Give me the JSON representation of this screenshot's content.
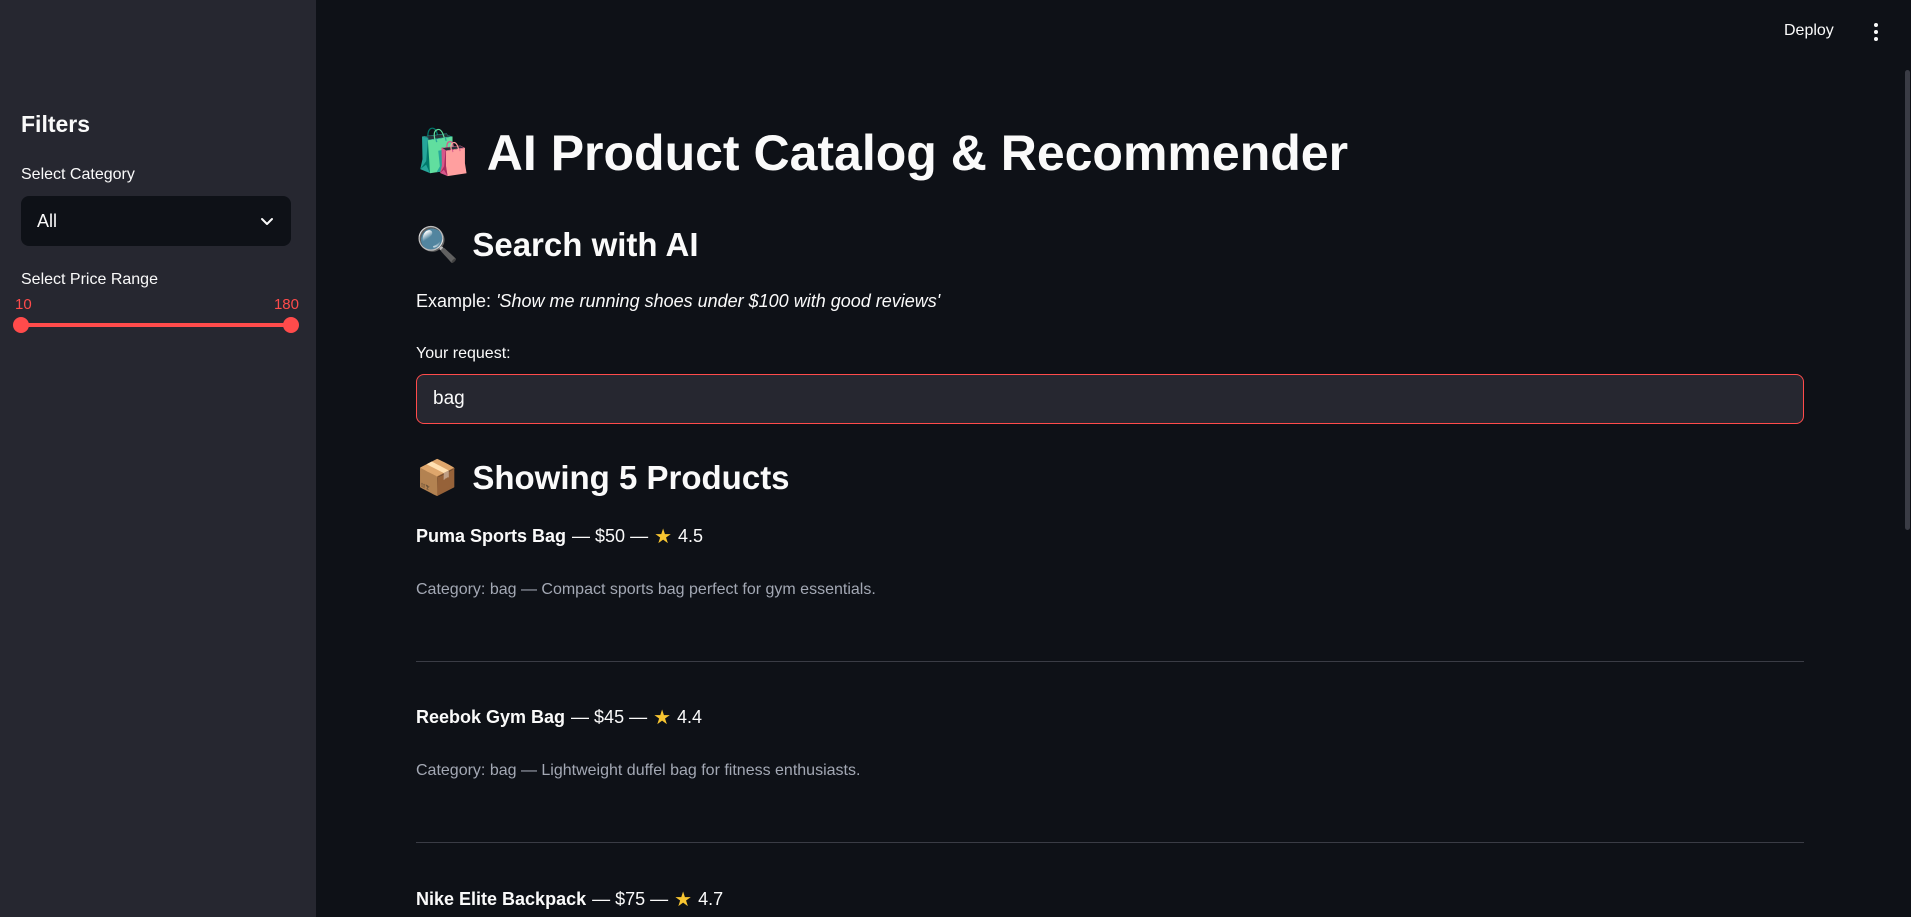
{
  "header": {
    "deploy_label": "Deploy",
    "menu_icon": "kebab-icon"
  },
  "sidebar": {
    "title": "Filters",
    "category_label": "Select Category",
    "category_value": "All",
    "price_label": "Select Price Range",
    "price_min": "10",
    "price_max": "180",
    "accent_color": "#ff4b4b"
  },
  "main": {
    "title_emoji": "🛍️",
    "title": "AI Product Catalog & Recommender",
    "search_emoji": "🔍",
    "search_heading": "Search with AI",
    "example_prefix": "Example:",
    "example_text": "'Show me running shoes under $100 with good reviews'",
    "request_label": "Your request:",
    "request_value": "bag",
    "results_emoji": "📦",
    "results_heading": "Showing 5 Products",
    "products": [
      {
        "name": "Puma Sports Bag",
        "price_part": "— $50 —",
        "star": "★",
        "rating": "4.5",
        "desc": "Category: bag — Compact sports bag perfect for gym essentials."
      },
      {
        "name": "Reebok Gym Bag",
        "price_part": "— $45 —",
        "star": "★",
        "rating": "4.4",
        "desc": "Category: bag — Lightweight duffel bag for fitness enthusiasts."
      },
      {
        "name": "Nike Elite Backpack",
        "price_part": "— $75 —",
        "star": "★",
        "rating": "4.7",
        "desc": ""
      }
    ]
  }
}
